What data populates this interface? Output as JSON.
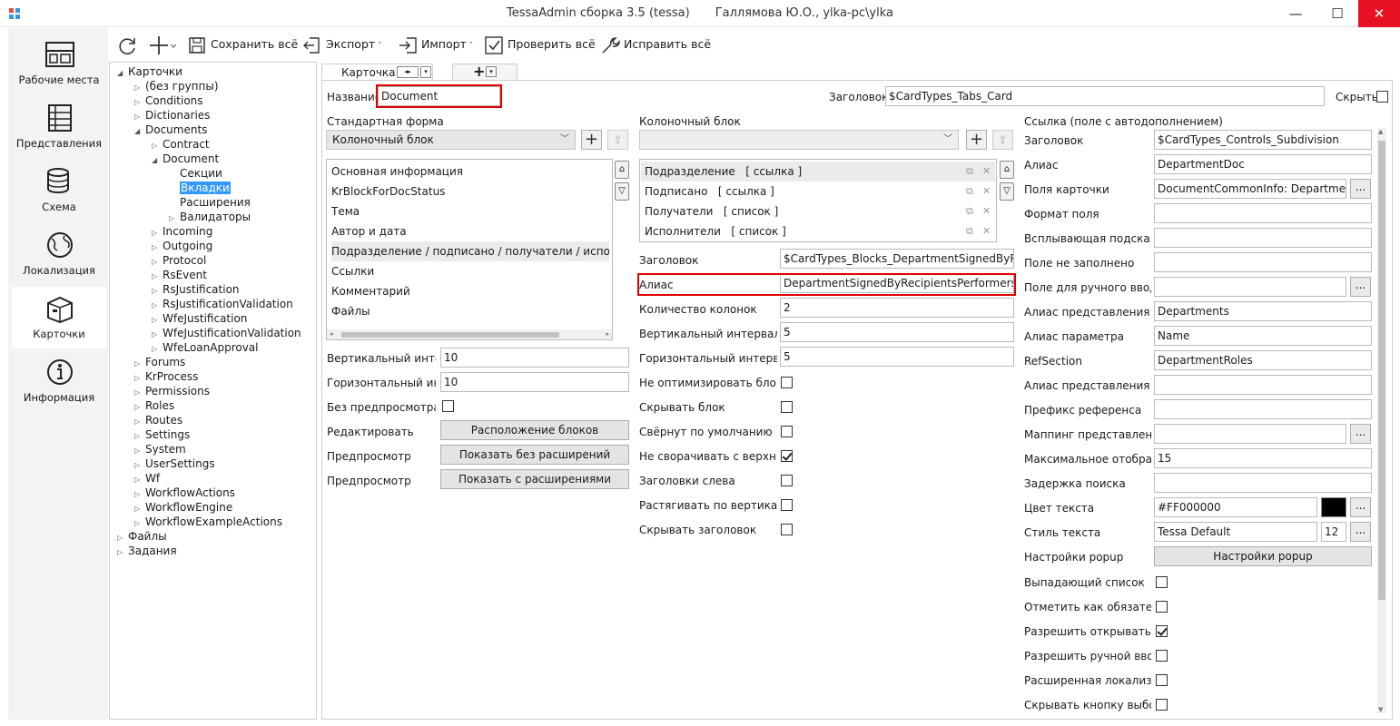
{
  "window": {
    "title": "TessaAdmin сборка 3.5 (tessa)",
    "user": "Галлямова Ю.О., ylka-pc\\ylka",
    "minimize": "—",
    "maximize": "☐",
    "close": "✕"
  },
  "sidebar": {
    "items": [
      {
        "label": "Рабочие места",
        "icon": "workplaces-icon"
      },
      {
        "label": "Представления",
        "icon": "views-icon"
      },
      {
        "label": "Схема",
        "icon": "database-icon"
      },
      {
        "label": "Локализация",
        "icon": "globe-icon"
      },
      {
        "label": "Карточки",
        "icon": "cards-box-icon"
      },
      {
        "label": "Информация",
        "icon": "info-icon"
      }
    ]
  },
  "toolbar": {
    "refresh_icon": "refresh-icon",
    "add_icon": "add-icon",
    "save_all": "Сохранить всё",
    "export": "Экспорт",
    "import": "Импорт",
    "check_all": "Проверить всё",
    "fix_all": "Исправить всё"
  },
  "tree": {
    "nodes": [
      {
        "label": "Карточки",
        "level": 0,
        "arrow": "◢"
      },
      {
        "label": "(без группы)",
        "level": 1,
        "arrow": "▷"
      },
      {
        "label": "Conditions",
        "level": 1,
        "arrow": "▷"
      },
      {
        "label": "Dictionaries",
        "level": 1,
        "arrow": "▷"
      },
      {
        "label": "Documents",
        "level": 1,
        "arrow": "◢"
      },
      {
        "label": "Contract",
        "level": 2,
        "arrow": "▷"
      },
      {
        "label": "Document",
        "level": 2,
        "arrow": "◢"
      },
      {
        "label": "Секции",
        "level": 3,
        "arrow": ""
      },
      {
        "label": "Вкладки",
        "level": 3,
        "arrow": "",
        "selected": true
      },
      {
        "label": "Расширения",
        "level": 3,
        "arrow": ""
      },
      {
        "label": "Валидаторы",
        "level": 3,
        "arrow": "▷"
      },
      {
        "label": "Incoming",
        "level": 2,
        "arrow": "▷"
      },
      {
        "label": "Outgoing",
        "level": 2,
        "arrow": "▷"
      },
      {
        "label": "Protocol",
        "level": 2,
        "arrow": "▷"
      },
      {
        "label": "RsEvent",
        "level": 2,
        "arrow": "▷"
      },
      {
        "label": "RsJustification",
        "level": 2,
        "arrow": "▷"
      },
      {
        "label": "RsJustificationValidation",
        "level": 2,
        "arrow": "▷"
      },
      {
        "label": "WfeJustification",
        "level": 2,
        "arrow": "▷"
      },
      {
        "label": "WfeJustificationValidation",
        "level": 2,
        "arrow": "▷"
      },
      {
        "label": "WfeLoanApproval",
        "level": 2,
        "arrow": "▷"
      },
      {
        "label": "Forums",
        "level": 1,
        "arrow": "▷"
      },
      {
        "label": "KrProcess",
        "level": 1,
        "arrow": "▷"
      },
      {
        "label": "Permissions",
        "level": 1,
        "arrow": "▷"
      },
      {
        "label": "Roles",
        "level": 1,
        "arrow": "▷"
      },
      {
        "label": "Routes",
        "level": 1,
        "arrow": "▷"
      },
      {
        "label": "Settings",
        "level": 1,
        "arrow": "▷"
      },
      {
        "label": "System",
        "level": 1,
        "arrow": "▷"
      },
      {
        "label": "UserSettings",
        "level": 1,
        "arrow": "▷"
      },
      {
        "label": "Wf",
        "level": 1,
        "arrow": "▷"
      },
      {
        "label": "WorkflowActions",
        "level": 1,
        "arrow": "▷"
      },
      {
        "label": "WorkflowEngine",
        "level": 1,
        "arrow": "▷"
      },
      {
        "label": "WorkflowExampleActions",
        "level": 1,
        "arrow": "▷"
      },
      {
        "label": "Файлы",
        "level": 0,
        "arrow": "▷"
      },
      {
        "label": "Задания",
        "level": 0,
        "arrow": "▷"
      }
    ]
  },
  "tabs": {
    "card_tab": "Карточка",
    "add_tab": "+"
  },
  "header": {
    "name_label": "Название",
    "name_value": "Document",
    "caption_label": "Заголовок",
    "caption_value": "$CardTypes_Tabs_Card",
    "hide_label": "Скрыть"
  },
  "col1": {
    "standard_form_label": "Стандартная форма",
    "standard_form_value": "Колоночный блок",
    "blocks": [
      "Основная информация",
      "KrBlockForDocStatus",
      "Тема",
      "Автор и дата",
      "Подразделение / подписано / получатели / исполнители",
      "Ссылки",
      "Комментарий",
      "Файлы"
    ],
    "vert_interval_label": "Вертикальный интер...",
    "vert_interval_value": "10",
    "horiz_interval_label": "Горизонтальный инт...",
    "horiz_interval_value": "10",
    "no_preview_label": "Без предпросмотра...",
    "edit_label": "Редактировать",
    "edit_button": "Расположение блоков",
    "preview1_label": "Предпросмотр",
    "preview1_button": "Показать без расширений",
    "preview2_label": "Предпросмотр",
    "preview2_button": "Показать с расширениями"
  },
  "col2": {
    "column_block_label": "Колоночный блок",
    "controls": [
      {
        "name": "Подразделение",
        "type": "[ ссылка ]"
      },
      {
        "name": "Подписано",
        "type": "[ ссылка ]"
      },
      {
        "name": "Получатели",
        "type": "[ список ]"
      },
      {
        "name": "Исполнители",
        "type": "[ список ]"
      }
    ],
    "fields": [
      {
        "label": "Заголовок",
        "value": "$CardTypes_Blocks_DepartmentSignedByRecipients"
      },
      {
        "label": "Алиас",
        "value": "DepartmentSignedByRecipientsPerformersBlock"
      },
      {
        "label": "Количество колонок",
        "value": "2"
      },
      {
        "label": "Вертикальный интервал м...",
        "value": "5"
      },
      {
        "label": "Горизонтальный интервал...",
        "value": "5"
      }
    ],
    "checks": [
      {
        "label": "Не оптимизировать блок",
        "checked": false
      },
      {
        "label": "Скрывать блок",
        "checked": false
      },
      {
        "label": "Свёрнут по умолчанию",
        "checked": false
      },
      {
        "label": "Не сворачивать с верхни...",
        "checked": true
      },
      {
        "label": "Заголовки слева",
        "checked": false
      },
      {
        "label": "Растягивать по вертикали",
        "checked": false
      },
      {
        "label": "Скрывать заголовок",
        "checked": false
      }
    ]
  },
  "col3": {
    "section_title": "Ссылка (поле с автодополнением)",
    "rows": [
      {
        "label": "Заголовок",
        "value": "$CardTypes_Controls_Subdivision"
      },
      {
        "label": "Алиас",
        "value": "DepartmentDoc"
      },
      {
        "label": "Поля карточки",
        "value": "DocumentCommonInfo: Department"
      },
      {
        "label": "Формат поля",
        "value": ""
      },
      {
        "label": "Всплывающая подсказка",
        "value": ""
      },
      {
        "label": "Поле не заполнено",
        "value": ""
      },
      {
        "label": "Поле для ручного ввода",
        "value": ""
      },
      {
        "label": "Алиас представления",
        "value": "Departments"
      },
      {
        "label": "Алиас параметра",
        "value": "Name"
      },
      {
        "label": "RefSection",
        "value": "DepartmentRoles"
      },
      {
        "label": "Алиас представления в...",
        "value": ""
      },
      {
        "label": "Префикс референса",
        "value": ""
      },
      {
        "label": "Маппинг представления",
        "value": ""
      },
      {
        "label": "Максимальное отображ...",
        "value": "15"
      },
      {
        "label": "Задержка поиска",
        "value": ""
      },
      {
        "label": "Цвет текста",
        "value": "#FF000000"
      },
      {
        "label": "Стиль текста",
        "value": "Tessa Default",
        "size": "12"
      },
      {
        "label": "Настройки popup",
        "button": "Настройки popup"
      }
    ],
    "checks": [
      {
        "label": "Выпадающий список",
        "checked": false
      },
      {
        "label": "Отметить как обязатель...",
        "checked": false
      },
      {
        "label": "Разрешить открывать сс...",
        "checked": true
      },
      {
        "label": "Разрешить ручной ввод",
        "checked": false
      },
      {
        "label": "Расширенная локализац...",
        "checked": false
      },
      {
        "label": "Скрывать кнопку выбора",
        "checked": false
      }
    ],
    "dots": "...",
    "color_swatch": "#000000"
  },
  "colors": {
    "accent": "#3399ff",
    "highlight_border": "#e00000",
    "close_button": "#e81123"
  }
}
